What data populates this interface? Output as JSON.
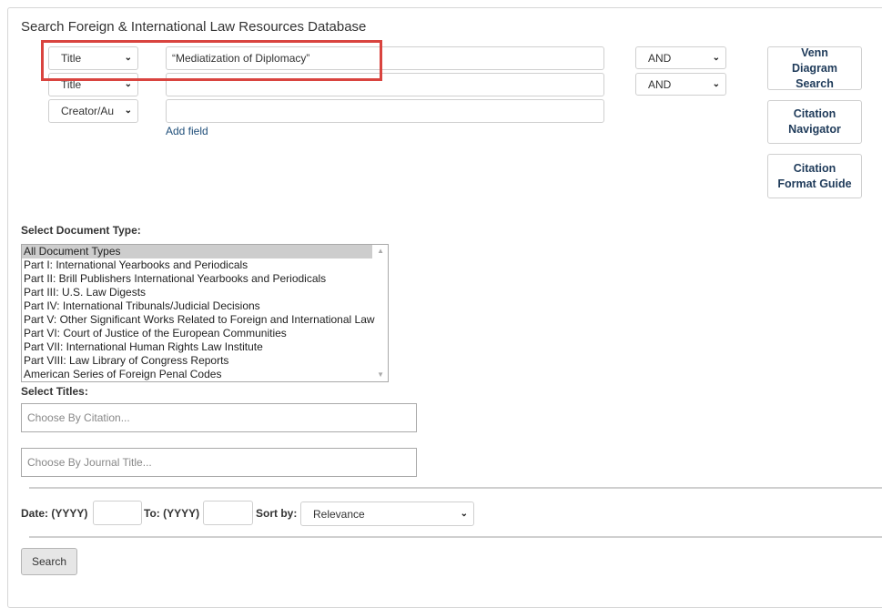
{
  "title": "Search Foreign & International Law Resources Database",
  "rows": [
    {
      "field": "Title",
      "value": "“Mediatization of Diplomacy”",
      "operator": "AND"
    },
    {
      "field": "Title",
      "value": "",
      "operator": "AND"
    },
    {
      "field": "Creator/Au",
      "value": ""
    }
  ],
  "add_field": "Add field",
  "buttons": {
    "venn": "Venn Diagram Search",
    "navigator": "Citation Navigator",
    "format": "Citation Format Guide",
    "search": "Search"
  },
  "doc_type": {
    "label": "Select Document Type:",
    "selected": "All Document Types",
    "options": [
      "All Document Types",
      "Part I: International Yearbooks and Periodicals",
      "Part II: Brill Publishers International Yearbooks and Periodicals",
      "Part III: U.S. Law Digests",
      "Part IV: International Tribunals/Judicial Decisions",
      "Part V: Other Significant Works Related to Foreign and International Law",
      "Part VI: Court of Justice of the European Communities",
      "Part VII: International Human Rights Law Institute",
      "Part VIII: Law Library of Congress Reports",
      "American Series of Foreign Penal Codes"
    ]
  },
  "titles": {
    "label": "Select Titles:",
    "citation_placeholder": "Choose By Citation...",
    "journal_placeholder": "Choose By Journal Title..."
  },
  "date": {
    "from_label": "Date: (YYYY)",
    "from_value": "",
    "to_label": "To: (YYYY)",
    "to_value": "",
    "sort_label": "Sort by:",
    "sort_value": "Relevance"
  },
  "colors": {
    "highlight": "#d9443f",
    "button_text": "#1f3b5a",
    "link": "#1f4e79"
  }
}
